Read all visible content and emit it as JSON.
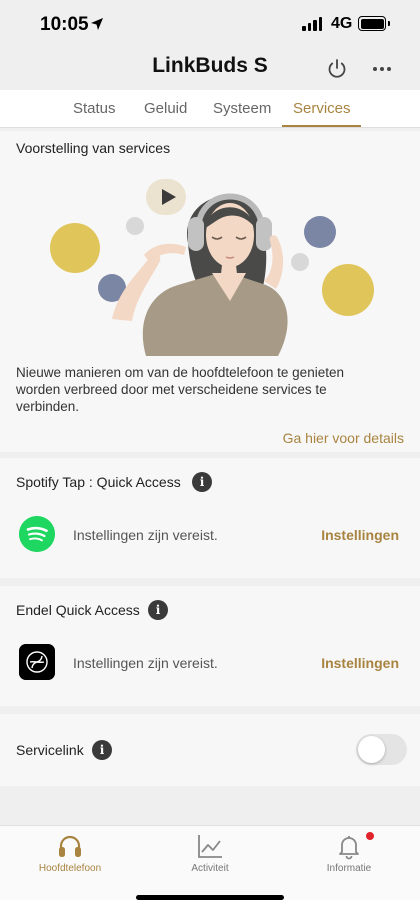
{
  "status_bar": {
    "time": "10:05",
    "network": "4G"
  },
  "header": {
    "title": "LinkBuds S"
  },
  "tabs": [
    {
      "label": "Status"
    },
    {
      "label": "Geluid"
    },
    {
      "label": "Systeem"
    },
    {
      "label": "Services",
      "active": true
    }
  ],
  "intro": {
    "title": "Voorstelling van services",
    "description": "Nieuwe manieren om van de hoofdtelefoon te genieten worden verbreed door met verscheidene services te verbinden.",
    "details_link": "Ga hier voor details"
  },
  "services": [
    {
      "name": "Spotify Tap : Quick Access",
      "status": "Instellingen zijn vereist.",
      "action": "Instellingen",
      "icon": "spotify-logo"
    },
    {
      "name": "Endel Quick Access",
      "status": "Instellingen zijn vereist.",
      "action": "Instellingen",
      "icon": "endel-logo"
    }
  ],
  "servicelink": {
    "label": "Servicelink",
    "enabled": false
  },
  "bottom_nav": [
    {
      "label": "Hoofdtelefoon",
      "icon": "headphones-icon",
      "active": true
    },
    {
      "label": "Activiteit",
      "icon": "activity-chart-icon"
    },
    {
      "label": "Informatie",
      "icon": "bell-icon",
      "badge": true
    }
  ],
  "colors": {
    "accent": "#a88440",
    "spotify": "#1ed760",
    "notification": "#e0242c"
  }
}
